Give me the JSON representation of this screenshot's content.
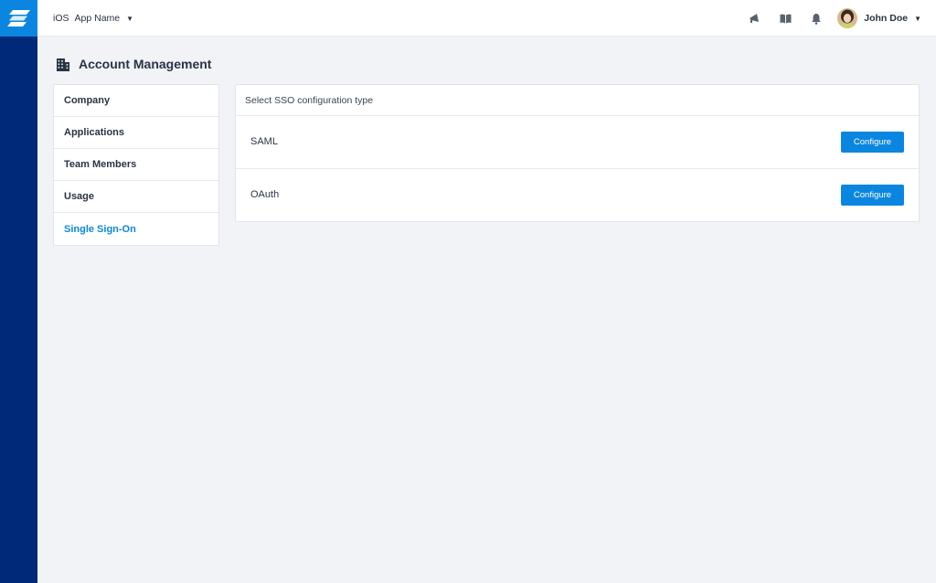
{
  "app": {
    "platform": "iOS",
    "name": "App Name",
    "brand_color": "#0b86e0",
    "rail_color": "#00297a"
  },
  "topbar": {
    "icons": [
      "megaphone-icon",
      "book-icon",
      "bell-icon"
    ],
    "user": {
      "name": "John Doe"
    }
  },
  "page": {
    "title": "Account Management",
    "icon": "building-icon"
  },
  "sidebar": {
    "items": [
      {
        "label": "Company",
        "active": false
      },
      {
        "label": "Applications",
        "active": false
      },
      {
        "label": "Team Members",
        "active": false
      },
      {
        "label": "Usage",
        "active": false
      },
      {
        "label": "Single Sign-On",
        "active": true
      }
    ]
  },
  "sso": {
    "heading": "Select SSO configuration type",
    "options": [
      {
        "name": "SAML",
        "button": "Configure"
      },
      {
        "name": "OAuth",
        "button": "Configure"
      }
    ]
  }
}
